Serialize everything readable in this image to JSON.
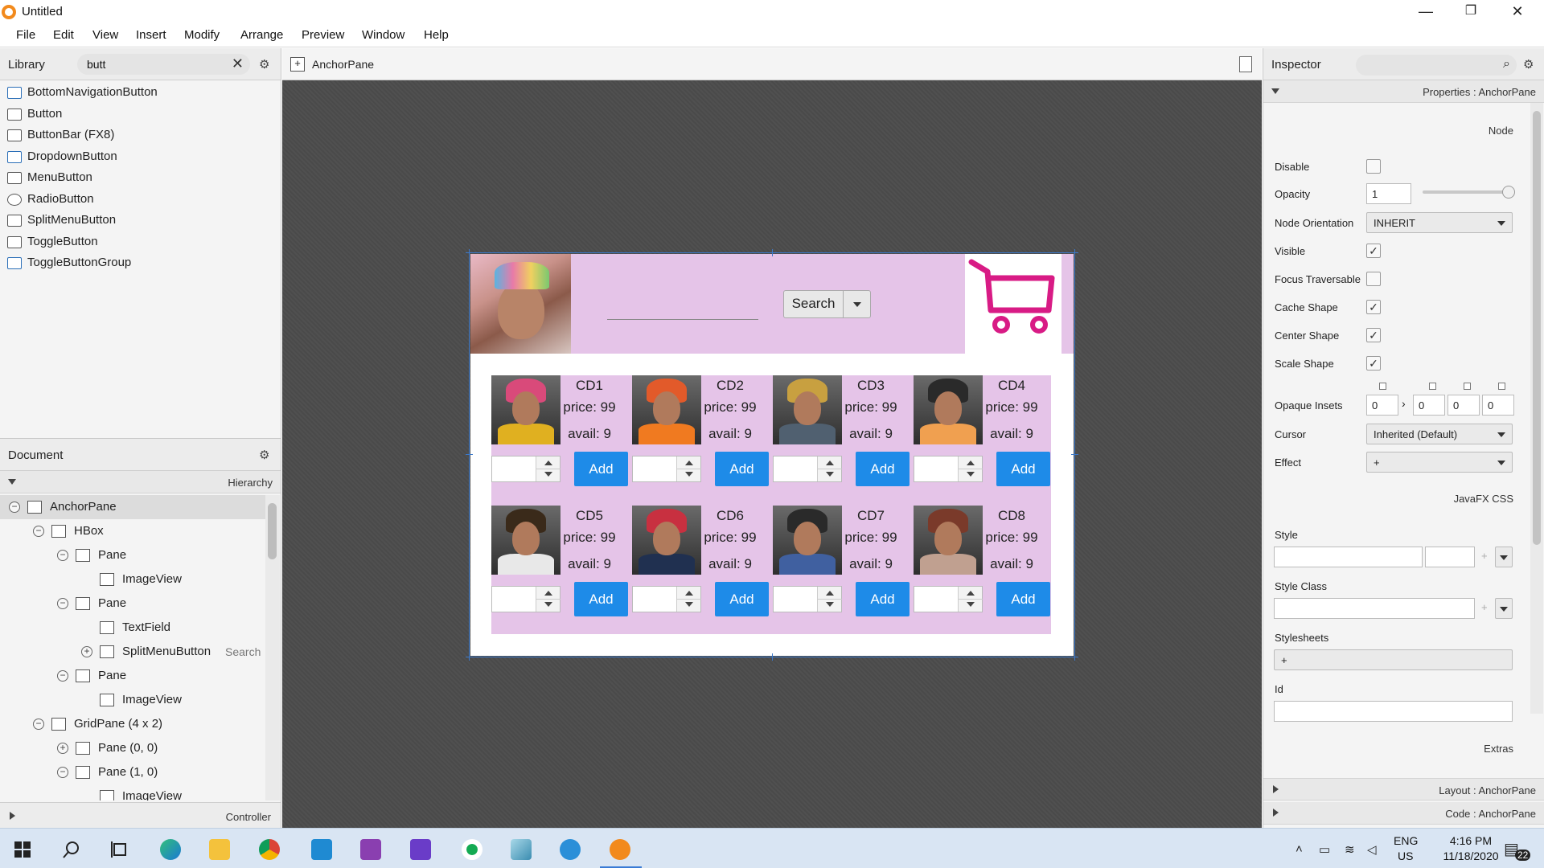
{
  "window": {
    "title": "Untitled",
    "controls": {
      "minimize": "—",
      "maximize": "❐",
      "close": "✕"
    }
  },
  "menu": [
    "File",
    "Edit",
    "View",
    "Insert",
    "Modify",
    "Arrange",
    "Preview",
    "Window",
    "Help"
  ],
  "library": {
    "title": "Library",
    "search_value": "butt",
    "items": [
      "BottomNavigationButton",
      "Button",
      "ButtonBar  (FX8)",
      "DropdownButton",
      "MenuButton",
      "RadioButton",
      "SplitMenuButton",
      "ToggleButton",
      "ToggleButtonGroup"
    ]
  },
  "document": {
    "title": "Document",
    "hierarchy_label": "Hierarchy",
    "controller_label": "Controller",
    "tree": [
      {
        "label": "AnchorPane",
        "depth": 0,
        "toggle": "−",
        "selected": true,
        "extra": ""
      },
      {
        "label": "HBox",
        "depth": 1,
        "toggle": "−",
        "selected": false,
        "extra": ""
      },
      {
        "label": "Pane",
        "depth": 2,
        "toggle": "−",
        "selected": false,
        "extra": ""
      },
      {
        "label": "ImageView",
        "depth": 3,
        "toggle": "",
        "selected": false,
        "extra": ""
      },
      {
        "label": "Pane",
        "depth": 2,
        "toggle": "−",
        "selected": false,
        "extra": ""
      },
      {
        "label": "TextField",
        "depth": 3,
        "toggle": "",
        "selected": false,
        "extra": ""
      },
      {
        "label": "SplitMenuButton",
        "depth": 3,
        "toggle": "+",
        "selected": false,
        "extra": "Search"
      },
      {
        "label": "Pane",
        "depth": 2,
        "toggle": "−",
        "selected": false,
        "extra": ""
      },
      {
        "label": "ImageView",
        "depth": 3,
        "toggle": "",
        "selected": false,
        "extra": ""
      },
      {
        "label": "GridPane (4 x 2)",
        "depth": 1,
        "toggle": "−",
        "selected": false,
        "extra": ""
      },
      {
        "label": "Pane (0, 0)",
        "depth": 2,
        "toggle": "+",
        "selected": false,
        "extra": ""
      },
      {
        "label": "Pane (1, 0)",
        "depth": 2,
        "toggle": "−",
        "selected": false,
        "extra": ""
      },
      {
        "label": "ImageView",
        "depth": 3,
        "toggle": "",
        "selected": false,
        "extra": ""
      }
    ]
  },
  "canvas": {
    "breadcrumb": "AnchorPane",
    "search_button": "Search",
    "products": [
      {
        "name": "CD1",
        "price": "price: 99",
        "avail": "avail: 9",
        "add": "Add",
        "hair": "#d94a7a",
        "shirt": "#e0b020"
      },
      {
        "name": "CD2",
        "price": "price: 99",
        "avail": "avail: 9",
        "add": "Add",
        "hair": "#e25a2a",
        "shirt": "#f07a20"
      },
      {
        "name": "CD3",
        "price": "price: 99",
        "avail": "avail: 9",
        "add": "Add",
        "hair": "#c8a040",
        "shirt": "#506070"
      },
      {
        "name": "CD4",
        "price": "price: 99",
        "avail": "avail: 9",
        "add": "Add",
        "hair": "#2a2a2a",
        "shirt": "#f0a050"
      },
      {
        "name": "CD5",
        "price": "price: 99",
        "avail": "avail: 9",
        "add": "Add",
        "hair": "#3a2a1a",
        "shirt": "#e8e8e8"
      },
      {
        "name": "CD6",
        "price": "price: 99",
        "avail": "avail: 9",
        "add": "Add",
        "hair": "#c83040",
        "shirt": "#203050"
      },
      {
        "name": "CD7",
        "price": "price: 99",
        "avail": "avail: 9",
        "add": "Add",
        "hair": "#2a2a2a",
        "shirt": "#4060a0"
      },
      {
        "name": "CD8",
        "price": "price: 99",
        "avail": "avail: 9",
        "add": "Add",
        "hair": "#7a3a2a",
        "shirt": "#c0a090"
      }
    ],
    "colors": {
      "strip": "#e5c4e8",
      "cart": "#d81b85",
      "add_button": "#1e8be8"
    }
  },
  "inspector": {
    "title": "Inspector",
    "properties_bar": "Properties : AnchorPane",
    "node_section": "Node",
    "disable": "Disable",
    "opacity": "Opacity",
    "opacity_value": "1",
    "node_orientation": "Node Orientation",
    "node_orientation_value": "INHERIT",
    "visible": "Visible",
    "focus_traversable": "Focus Traversable",
    "cache_shape": "Cache Shape",
    "center_shape": "Center Shape",
    "scale_shape": "Scale Shape",
    "opaque_insets": "Opaque Insets",
    "insets": [
      "0",
      "0",
      "0",
      "0"
    ],
    "cursor": "Cursor",
    "cursor_value": "Inherited (Default)",
    "effect": "Effect",
    "effect_value": "+",
    "css_section": "JavaFX CSS",
    "style": "Style",
    "style_class": "Style Class",
    "stylesheets": "Stylesheets",
    "stylesheets_add": "+",
    "id": "Id",
    "extras": "Extras",
    "layout_bar": "Layout : AnchorPane",
    "code_bar": "Code : AnchorPane",
    "checks": {
      "disable": false,
      "visible": true,
      "focus": false,
      "cache": true,
      "center": true,
      "scale": true
    },
    "opacity_level": 1
  },
  "taskbar": {
    "lang_top": "ENG",
    "lang_bottom": "US",
    "time": "4:16 PM",
    "date": "11/18/2020",
    "notif_count": "22"
  }
}
